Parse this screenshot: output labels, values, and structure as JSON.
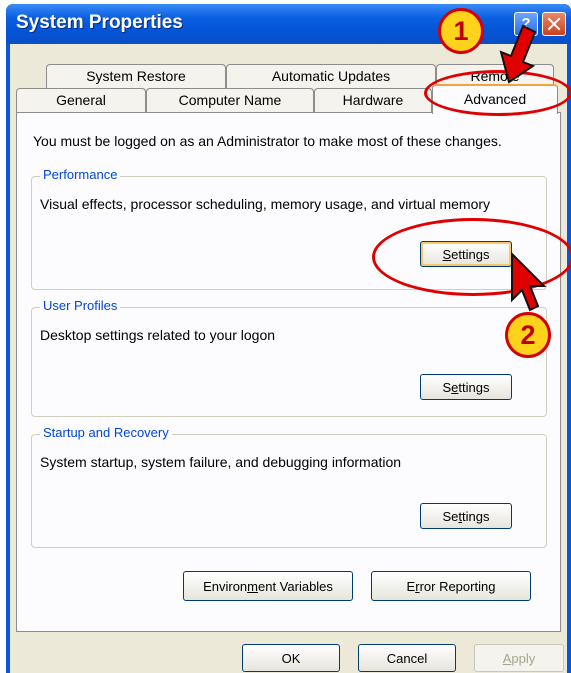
{
  "window": {
    "title": "System Properties",
    "help_glyph": "?"
  },
  "tabs": {
    "row1": [
      "System Restore",
      "Automatic Updates",
      "Remote"
    ],
    "row2": [
      "General",
      "Computer Name",
      "Hardware",
      "Advanced"
    ],
    "active": "Advanced"
  },
  "advanced": {
    "intro": "You must be logged on as an Administrator to make most of these changes.",
    "performance": {
      "title": "Performance",
      "desc": "Visual effects, processor scheduling, memory usage, and virtual memory",
      "button": "Settings"
    },
    "user_profiles": {
      "title": "User Profiles",
      "desc": "Desktop settings related to your logon",
      "button": "Settings"
    },
    "startup_recovery": {
      "title": "Startup and Recovery",
      "desc": "System startup, system failure, and debugging information",
      "button": "Settings"
    },
    "env_vars_button": "Environment Variables",
    "error_reporting_button": "Error Reporting"
  },
  "footer": {
    "ok": "OK",
    "cancel": "Cancel",
    "apply": "Apply"
  },
  "annotations": {
    "step1": "1",
    "step2": "2",
    "color": "#e00000",
    "badge_fill": "#ffd21c"
  },
  "colors": {
    "title_bar": "#0453d6",
    "dialog_bg": "#ece9d8",
    "group_title": "#0046d5",
    "active_tab_accent": "#f1a43c"
  }
}
